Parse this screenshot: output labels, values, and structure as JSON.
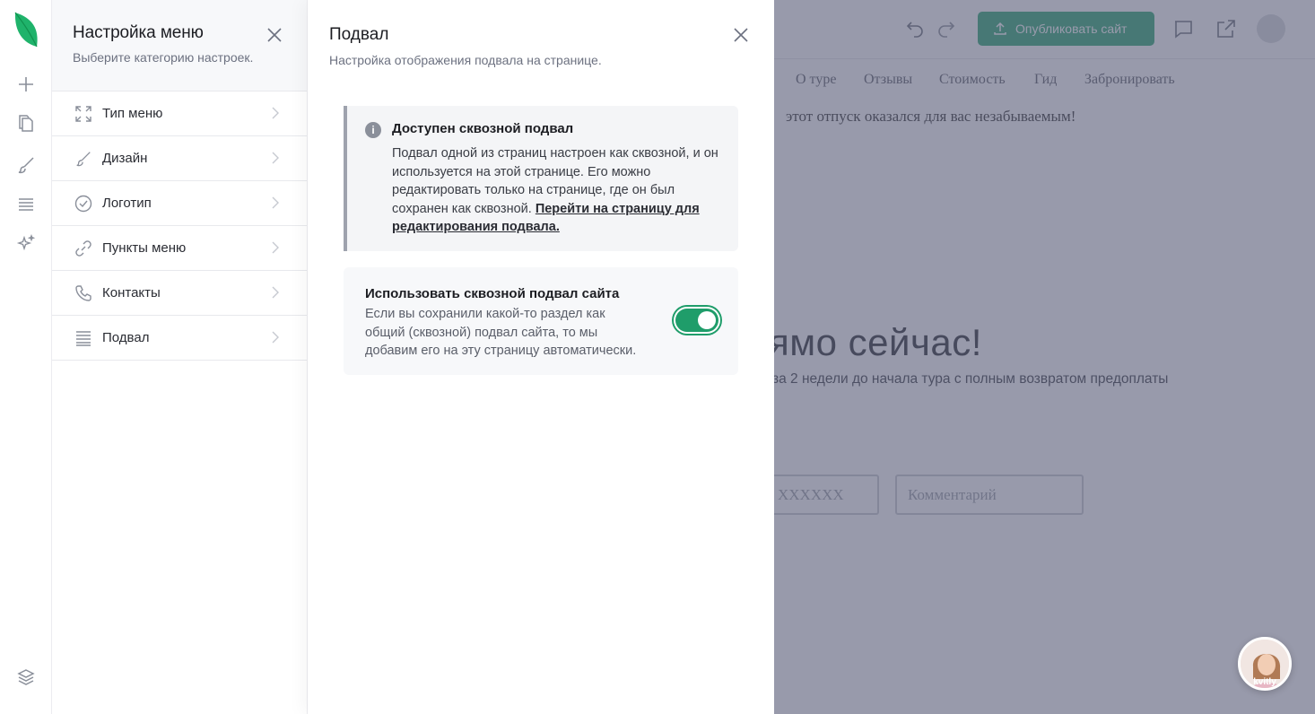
{
  "menu_panel": {
    "title": "Настройка меню",
    "subtitle": "Выберите категорию настроек.",
    "items": [
      {
        "label": "Тип меню",
        "icon": "expand-icon"
      },
      {
        "label": "Дизайн",
        "icon": "brush-icon"
      },
      {
        "label": "Логотип",
        "icon": "check-circle-icon"
      },
      {
        "label": "Пункты меню",
        "icon": "link-icon"
      },
      {
        "label": "Контакты",
        "icon": "phone-icon"
      },
      {
        "label": "Подвал",
        "icon": "lines-icon"
      }
    ]
  },
  "footer_panel": {
    "title": "Подвал",
    "subtitle": "Настройка отображения подвала на странице.",
    "info": {
      "title": "Доступен сквозной подвал",
      "text": "Подвал одной из страниц настроен как сквозной, и он используется на этой странице. Его можно редактировать только на странице, где он был сохранен как сквозной. ",
      "link": "Перейти на страницу для редактирования подвала."
    },
    "toggle": {
      "title": "Использовать сквозной подвал сайта",
      "text": "Если вы сохранили какой-то раздел как общий (сквозной) подвал сайта, то мы добавим его на эту страницу автоматически.",
      "enabled": true,
      "color": "#1f9d6a"
    }
  },
  "background": {
    "publish_label": "Опубликовать сайт",
    "nav": [
      "О туре",
      "Отзывы",
      "Стоимость",
      "Гид",
      "Забронировать"
    ],
    "top_text": "этот отпуск оказался для вас незабываемым!",
    "heading": "ямо сейчас!",
    "subheading": "за 2 недели до начала тура с полным возвратом предоплаты",
    "phone_placeholder": "XXXXXX",
    "comment_placeholder": "Комментарий"
  },
  "chat": {
    "label": "kvitly"
  },
  "colors": {
    "accent": "#2aa772",
    "brand_leaf": "#1fb36b"
  }
}
